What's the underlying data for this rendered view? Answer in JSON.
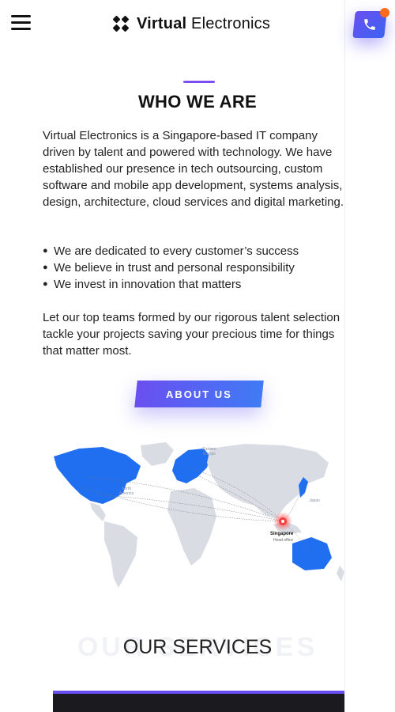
{
  "header": {
    "brand_bold": "Virtual",
    "brand_light": "Electronics",
    "menu_icon": "hamburger-menu-icon",
    "call_icon": "phone-icon"
  },
  "about": {
    "title": "WHO WE ARE",
    "intro": "Virtual Electronics is a Singapore-based IT company driven by talent and powered with technology. We have established our presence in tech outsourcing, custom software and mobile app development, systems analysis, design, architecture, cloud services and digital marketing.",
    "bullets": [
      "We are dedicated to every customer’s success",
      "We believe in trust and personal responsibility",
      "We invest in innovation that matters"
    ],
    "closing": "Let our top teams formed by our rigorous talent selection tackle your projects saving your precious time for things that matter most.",
    "button_label": "ABOUT US"
  },
  "map": {
    "hq_label": "Singapore",
    "hq_sub": "Head office",
    "region_labels": [
      "Eastern Europe",
      "North America",
      "Japan"
    ],
    "highlight_color": "#1f6ff0",
    "land_color": "#d9dde3"
  },
  "services": {
    "title": "OUR SERVICES",
    "ghost": "OUR SERVICES"
  },
  "colors": {
    "accent_purple": "#6a4ff0",
    "accent_blue": "#3f7bf5",
    "notification": "#ff6b1a"
  }
}
